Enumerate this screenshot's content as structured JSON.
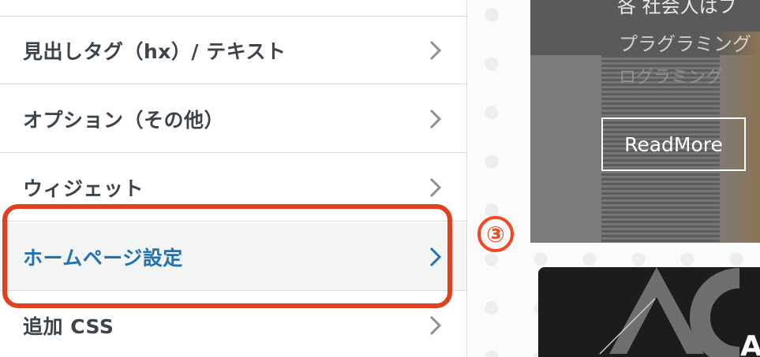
{
  "sidebar": {
    "items": [
      {
        "label": "見出しタグ（hx）/ テキスト",
        "active": false
      },
      {
        "label": "オプション（その他）",
        "active": false
      },
      {
        "label": "ウィジェット",
        "active": false
      },
      {
        "label": "ホームページ設定",
        "active": true
      },
      {
        "label": "追加 CSS",
        "active": false
      }
    ]
  },
  "annotation": {
    "step": "③",
    "color": "#e2411f"
  },
  "preview": {
    "hero": {
      "line1": "各 社会人はフ",
      "line2": "プラグラミング",
      "line3": "ログラミング",
      "button_label": "ReadMore"
    },
    "thumbnail": {
      "letter": "A"
    }
  },
  "colors": {
    "accent": "#2271b1",
    "text": "#3c434a",
    "highlight": "#e2411f"
  },
  "icons": {
    "chevron": "chevron-right-icon"
  }
}
